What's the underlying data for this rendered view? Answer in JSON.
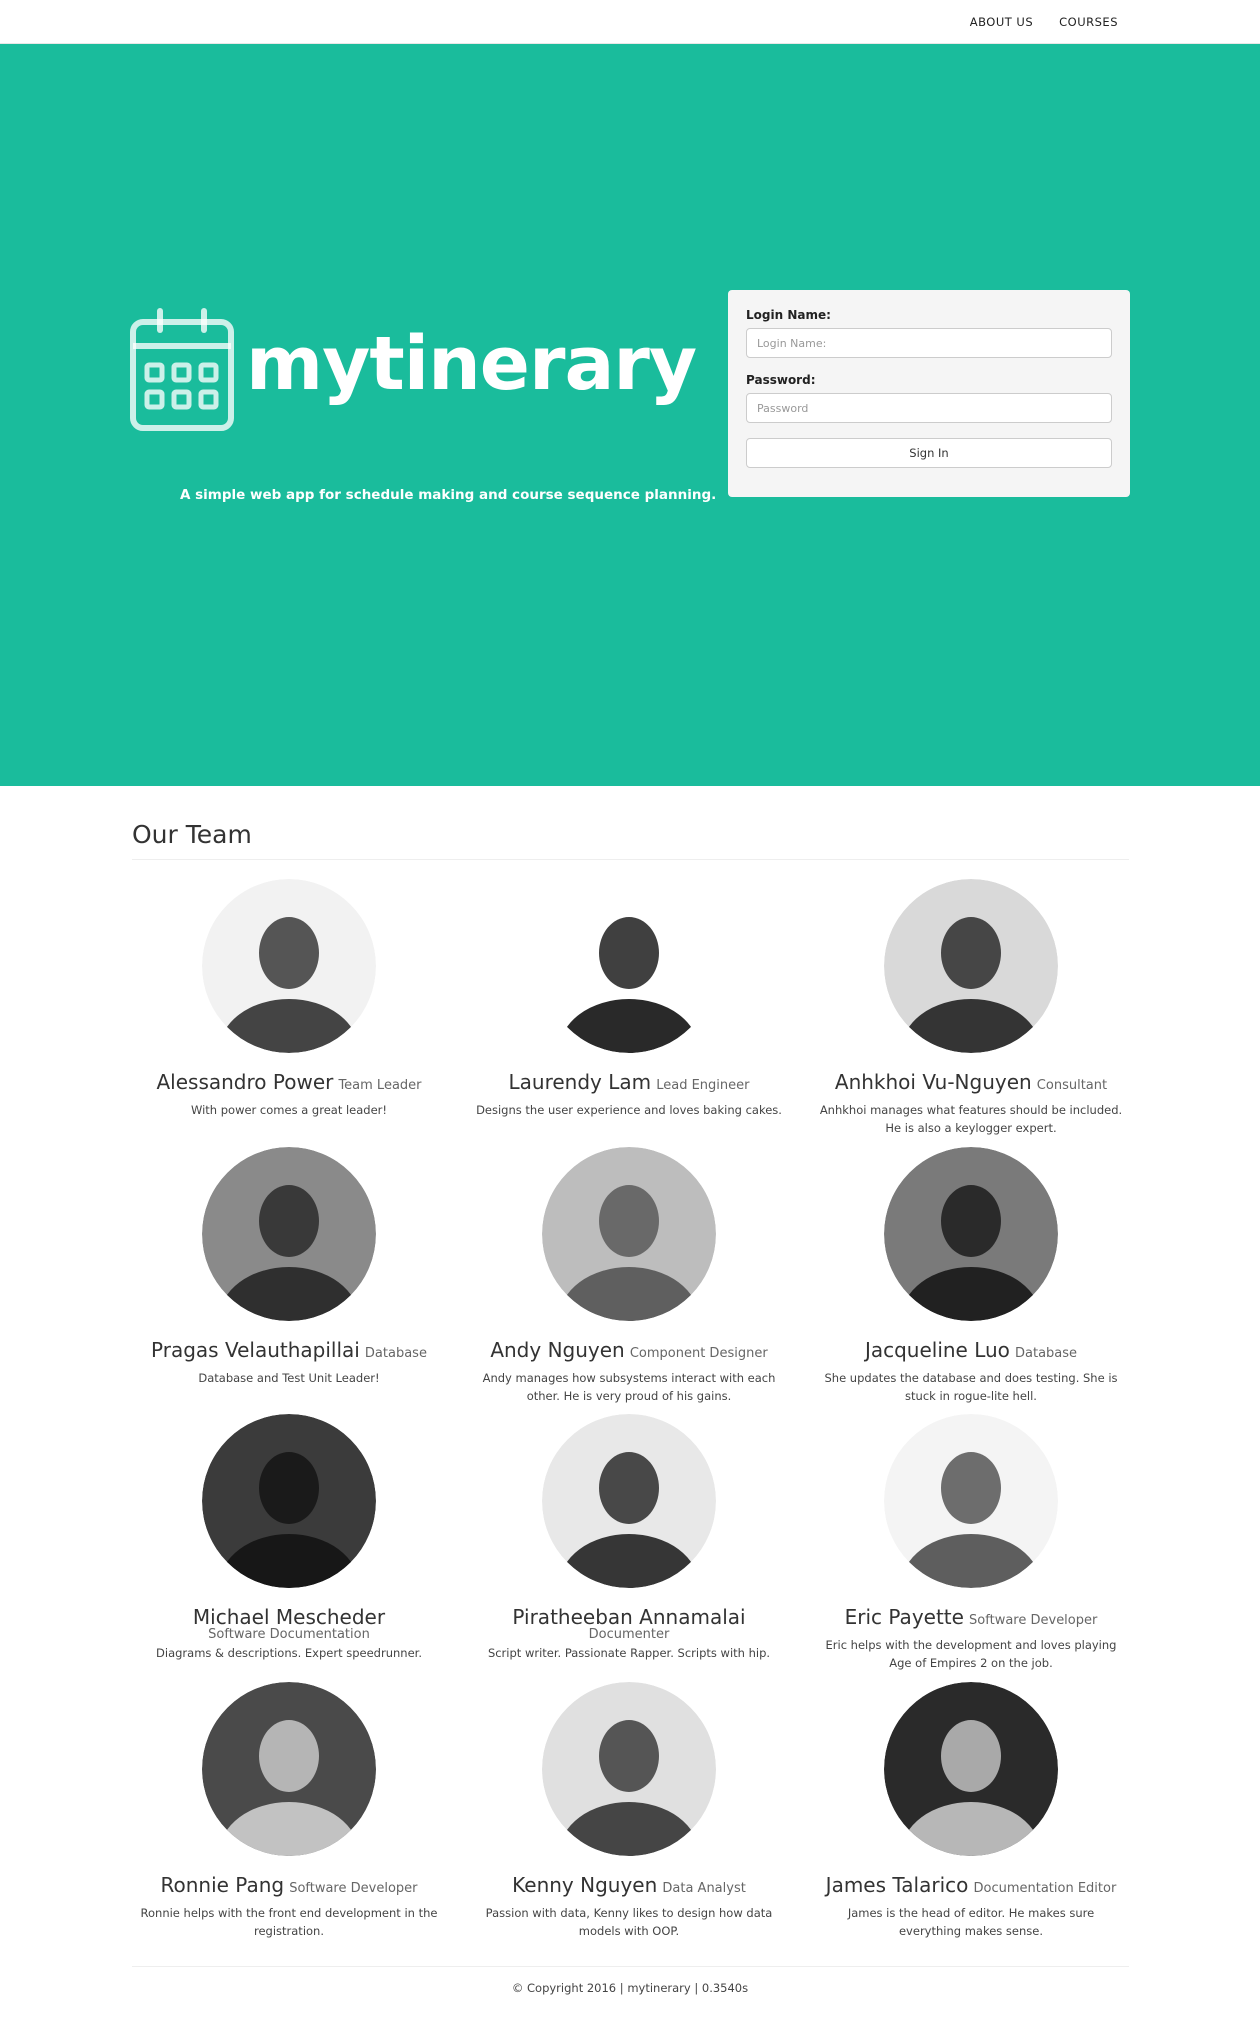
{
  "nav": {
    "items": [
      "ABOUT US",
      "COURSES"
    ]
  },
  "hero": {
    "brand_name": "mytinerary",
    "tagline": "A simple web app for schedule making and course sequence planning.",
    "accent_color": "#1abc9c",
    "icon": "calendar-icon"
  },
  "login": {
    "name_label": "Login Name:",
    "name_placeholder": "Login Name:",
    "name_value": "",
    "password_label": "Password:",
    "password_placeholder": "Password",
    "password_value": "",
    "signin_label": "Sign In"
  },
  "team": {
    "heading": "Our Team",
    "members": [
      {
        "name": "Alessandro Power",
        "role": "Team Leader",
        "description": "With power comes a great leader!"
      },
      {
        "name": "Laurendy Lam",
        "role": "Lead Engineer",
        "description": "Designs the user experience and loves baking cakes."
      },
      {
        "name": "Anhkhoi Vu-Nguyen",
        "role": "Consultant",
        "description": "Anhkhoi manages what features should be included. He is also a keylogger expert."
      },
      {
        "name": "Pragas Velauthapillai",
        "role": "Database",
        "description": "Database and Test Unit Leader!"
      },
      {
        "name": "Andy Nguyen",
        "role": "Component Designer",
        "description": "Andy manages how subsystems interact with each other. He is very proud of his gains."
      },
      {
        "name": "Jacqueline Luo",
        "role": "Database",
        "description": "She updates the database and does testing. She is stuck in rogue-lite hell."
      },
      {
        "name": "Michael Mescheder",
        "role": "Software Documentation",
        "description": "Diagrams & descriptions. Expert speedrunner."
      },
      {
        "name": "Piratheeban Annamalai",
        "role": "Documenter",
        "description": "Script writer. Passionate Rapper. Scripts with hip."
      },
      {
        "name": "Eric Payette",
        "role": "Software Developer",
        "description": "Eric helps with the development and loves playing Age of Empires 2 on the job."
      },
      {
        "name": "Ronnie Pang",
        "role": "Software Developer",
        "description": "Ronnie helps with the front end development in the registration."
      },
      {
        "name": "Kenny Nguyen",
        "role": "Data Analyst",
        "description": "Passion with data, Kenny likes to design how data models with OOP."
      },
      {
        "name": "James Talarico",
        "role": "Documentation Editor",
        "description": "James is the head of editor. He makes sure everything makes sense."
      }
    ]
  },
  "footer": {
    "text": "© Copyright 2016 | mytinerary | 0.3540s"
  }
}
